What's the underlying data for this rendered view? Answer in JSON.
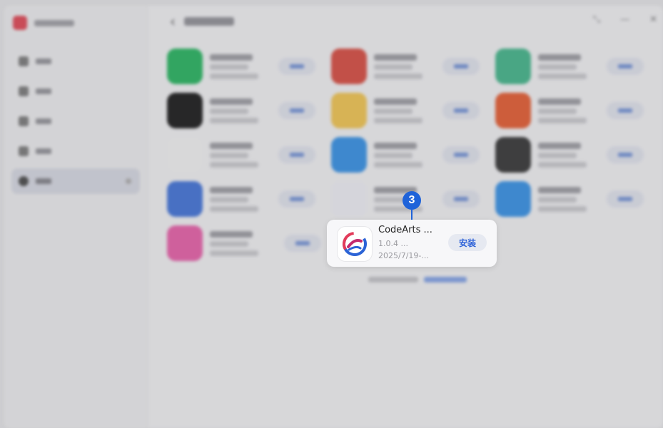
{
  "background_app": {
    "apps": [
      {
        "icon_color": "#1fb35a"
      },
      {
        "icon_color": "#d8463a"
      },
      {
        "icon_color": "#3db487"
      },
      {
        "icon_color": "#111111"
      },
      {
        "icon_color": "#f2c44b"
      },
      {
        "icon_color": "#e6572a"
      },
      {
        "icon_color": "#f4f4f4"
      },
      {
        "icon_color": "#2f8ee6"
      },
      {
        "icon_color": "#2f2f2f"
      },
      {
        "icon_color": "#3b6fd8"
      },
      {
        "icon_color": "#f0f0f6"
      },
      {
        "icon_color": "#2f8ee6"
      },
      {
        "icon_color": "#e85aa6"
      }
    ]
  },
  "focus_card": {
    "name": "CodeArts ...",
    "version": "1.0.4 ...",
    "date": "2025/7/19-...",
    "install_label": "安装",
    "icon": "codearts-logo-icon"
  },
  "callout": {
    "number": "3",
    "color": "#1f63d9"
  },
  "colors": {
    "accent": "#2f63d8",
    "install_bg": "#e6e9f1"
  }
}
